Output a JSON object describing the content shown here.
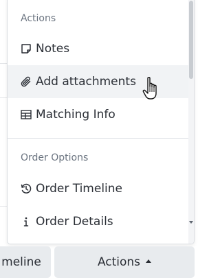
{
  "menu": {
    "sections": [
      {
        "header": "Actions",
        "items": [
          {
            "label": "Notes",
            "icon": "note-icon"
          },
          {
            "label": "Add attachments",
            "icon": "paperclip-icon"
          },
          {
            "label": "Matching Info",
            "icon": "table-icon"
          }
        ]
      },
      {
        "header": "Order Options",
        "items": [
          {
            "label": "Order Timeline",
            "icon": "history-icon"
          },
          {
            "label": "Order Details",
            "icon": "info-icon"
          }
        ]
      }
    ]
  },
  "buttons": {
    "timeline_label": "meline",
    "actions_label": "Actions"
  },
  "cursor": "hand-pointer-icon"
}
